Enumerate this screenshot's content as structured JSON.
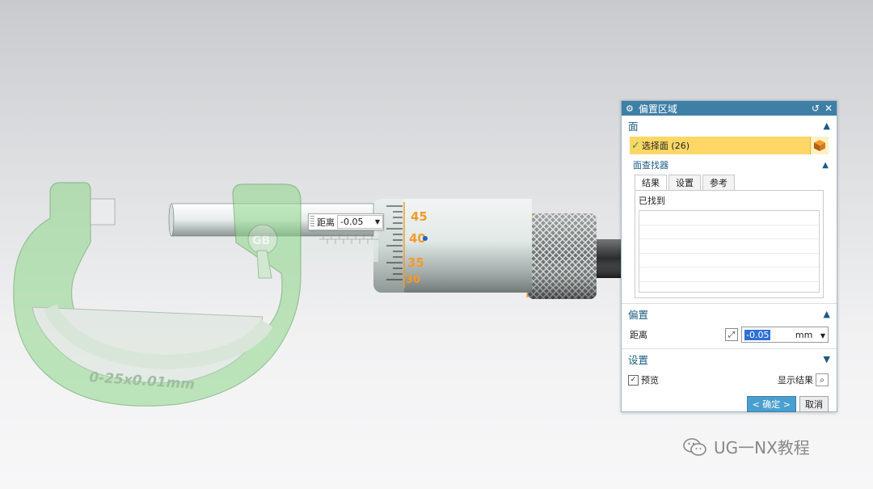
{
  "model": {
    "frame_text": "0-25x0.01mm",
    "thimble_numbers": [
      "45",
      "40",
      "35",
      "30"
    ],
    "logo_text": "GB"
  },
  "inline_input": {
    "label": "距离",
    "value": "-0.05"
  },
  "dialog": {
    "title": "偏置区域",
    "face_section": {
      "title": "面",
      "select_label": "选择面 (26)",
      "finder": {
        "title": "面查找器",
        "tabs": [
          "结果",
          "设置",
          "参考"
        ],
        "found_label": "已找到"
      }
    },
    "offset_section": {
      "title": "偏置",
      "distance_label": "距离",
      "distance_value": "-0.05",
      "unit": "mm"
    },
    "settings_section": {
      "title": "设置"
    },
    "preview_label": "预览",
    "show_result_label": "显示结果",
    "ok_label": "< 确定 >",
    "cancel_label": "取消"
  },
  "watermark": {
    "text": "UG一NX教程"
  },
  "colors": {
    "accent": "#3f7fa6",
    "selection": "#ffd766",
    "frame_green": "#9ed99a",
    "thimble_orange": "#f39a2c"
  }
}
